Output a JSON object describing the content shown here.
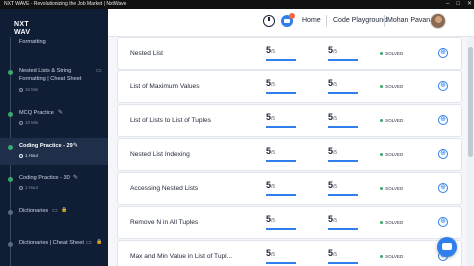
{
  "window": {
    "title": "NXT WAVE - Revolutionizing the Job Market | NxtWave",
    "controls": [
      "–",
      "□",
      "✕"
    ]
  },
  "header": {
    "logo_line1": "NXT",
    "logo_line2": "WAV",
    "nav_home": "Home",
    "nav_code_playground": "Code Playground",
    "user_name": "Mohan Pavan"
  },
  "sidebar": {
    "items": [
      {
        "title": "Formatting",
        "meta": "",
        "status": "done"
      },
      {
        "title": "Nested Lists & String",
        "title2": "Formatting | Cheat Sheet",
        "meta": "15 Min",
        "status": "done"
      },
      {
        "title": "MCQ Practice",
        "meta": "10 Min",
        "status": "done"
      },
      {
        "title": "Coding Practice - 29",
        "meta": "1 Hour",
        "status": "done",
        "active": true
      },
      {
        "title": "Coding Practice - 30",
        "meta": "1 Hour",
        "status": "done"
      },
      {
        "title": "Dictionaries",
        "meta": "",
        "status": "locked"
      },
      {
        "title": "Dictionaries | Cheat Sheet",
        "meta": "",
        "status": "locked"
      }
    ]
  },
  "questions": [
    {
      "title": "Nested List",
      "score": "5",
      "total": "/5",
      "progress": 1.0,
      "status": "SOLVED"
    },
    {
      "title": "List of Maximum Values",
      "score": "5",
      "total": "/5",
      "progress": 1.0,
      "status": "SOLVED"
    },
    {
      "title": "List of Lists to List of Tuples",
      "score": "5",
      "total": "/5",
      "progress": 1.0,
      "status": "SOLVED"
    },
    {
      "title": "Nested List Indexing",
      "score": "5",
      "total": "/5",
      "progress": 1.0,
      "status": "SOLVED"
    },
    {
      "title": "Accessing Nested Lists",
      "score": "5",
      "total": "/5",
      "progress": 1.0,
      "status": "SOLVED"
    },
    {
      "title": "Remove N in All Tuples",
      "score": "5",
      "total": "/5",
      "progress": 1.0,
      "status": "SOLVED"
    },
    {
      "title": "Max and Min Value in List of Tupl...",
      "score": "5",
      "total": "/5",
      "progress": 1.0,
      "status": "SOLVED"
    }
  ],
  "icons": {
    "go": "⊕",
    "edit": "✎",
    "lock": "🔒"
  }
}
